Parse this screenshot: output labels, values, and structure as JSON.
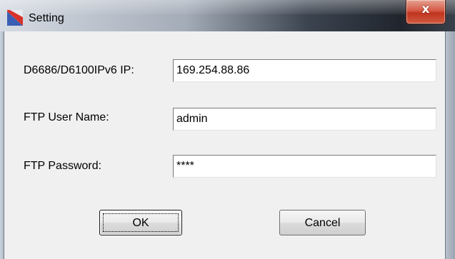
{
  "window": {
    "title": "Setting",
    "app_icon": "app-logo-icon",
    "close_glyph": "x"
  },
  "form": {
    "ip": {
      "label": "D6686/D6100IPv6 IP:",
      "value": "169.254.88.86"
    },
    "username": {
      "label": "FTP User Name:",
      "value": "admin"
    },
    "password": {
      "label": "FTP Password:",
      "value": "****"
    }
  },
  "buttons": {
    "ok_label": "OK",
    "cancel_label": "Cancel"
  },
  "colors": {
    "close_button": "#c8402a",
    "dialog_background": "#f0f0f0"
  }
}
